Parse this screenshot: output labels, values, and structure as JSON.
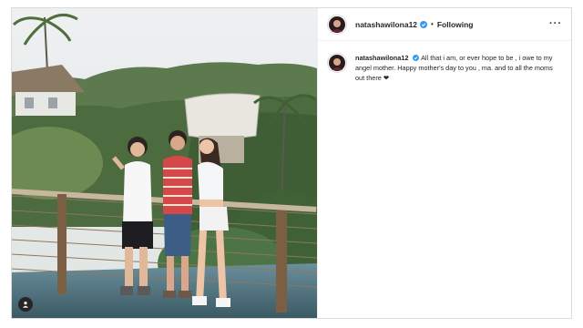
{
  "post": {
    "username": "natashawilona12",
    "follow_status": "Following",
    "more_label": "···",
    "caption": "All that i am, or ever hope to be , i owe to my angel mother. Happy mother's day to you , ma. and to all the moms out there ❤"
  },
  "icons": {
    "verified": "verified-badge-icon",
    "tag": "user-tag-icon",
    "more": "more-options-icon"
  },
  "colors": {
    "verified_blue": "#3897f0",
    "text": "#262626",
    "border": "#dbdbdb"
  }
}
